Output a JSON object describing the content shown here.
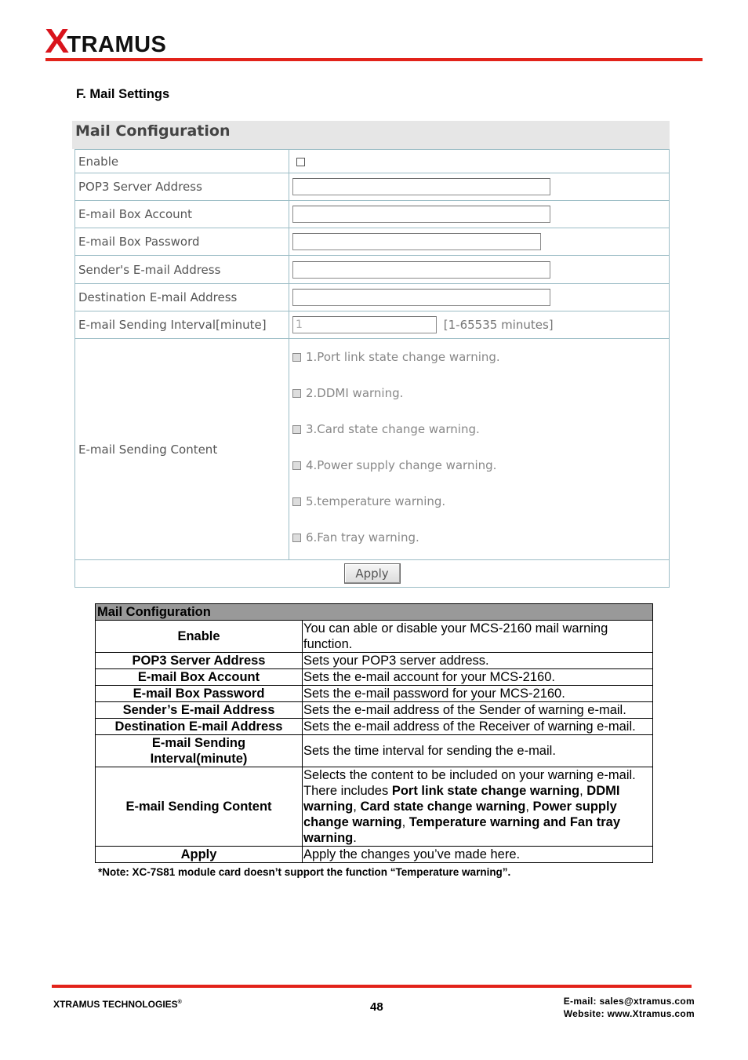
{
  "header": {
    "logo_x": "X",
    "logo_rest": "TRAMUS",
    "brand_color": "#e2231a"
  },
  "section_heading": "F. Mail Settings",
  "ui_screenshot": {
    "title": "Mail Configuration",
    "rows": [
      {
        "label": "Enable",
        "type": "checkbox",
        "checked": false
      },
      {
        "label": "POP3 Server Address",
        "type": "text",
        "value": ""
      },
      {
        "label": "E-mail Box Account",
        "type": "text",
        "value": ""
      },
      {
        "label": "E-mail Box Password",
        "type": "password",
        "value": ""
      },
      {
        "label": "Sender's E-mail Address",
        "type": "text",
        "value": ""
      },
      {
        "label": "Destination E-mail Address",
        "type": "text",
        "value": ""
      },
      {
        "label": "E-mail Sending Interval[minute]",
        "type": "text",
        "value": "1",
        "hint": "[1-65535 minutes]"
      }
    ],
    "content_label": "E-mail Sending Content",
    "content_options": [
      "1.Port link state change warning.",
      "2.DDMI warning.",
      "3.Card state change warning.",
      "4.Power supply change warning.",
      "5.temperature warning.",
      "6.Fan tray warning."
    ],
    "apply_label": "Apply"
  },
  "desc_table": {
    "title": "Mail Configuration",
    "rows": [
      {
        "key": "Enable",
        "value": "You can able or disable your MCS-2160 mail warning function."
      },
      {
        "key": "POP3 Server Address",
        "value": "Sets your POP3 server address."
      },
      {
        "key": "E-mail Box Account",
        "value": "Sets the e-mail account for your MCS-2160."
      },
      {
        "key": "E-mail Box Password",
        "value": "Sets the e-mail password for your MCS-2160."
      },
      {
        "key": "Sender’s E-mail Address",
        "value": "Sets the e-mail address of the Sender of warning e-mail."
      },
      {
        "key": "Destination E-mail Address",
        "value": "Sets the e-mail address of the Receiver of warning e-mail."
      },
      {
        "key": "E-mail Sending Interval(minute)",
        "value": "Sets the time interval for sending the e-mail."
      },
      {
        "key": "E-mail Sending Content",
        "value_parts": [
          {
            "t": "Selects the content to be included on your warning e-mail. There includes ",
            "b": false
          },
          {
            "t": "Port link state change warning",
            "b": true
          },
          {
            "t": ", ",
            "b": false
          },
          {
            "t": "DDMI warning",
            "b": true
          },
          {
            "t": ", ",
            "b": false
          },
          {
            "t": "Card state change warning",
            "b": true
          },
          {
            "t": ", ",
            "b": false
          },
          {
            "t": "Power supply change warning",
            "b": true
          },
          {
            "t": ", ",
            "b": false
          },
          {
            "t": "Temperature warning and Fan tray warning",
            "b": true
          },
          {
            "t": ".",
            "b": false
          }
        ]
      },
      {
        "key": "Apply",
        "value": "Apply the changes you’ve made here."
      }
    ],
    "note": "*Note: XC-7S81 module card doesn’t support the function “Temperature warning”."
  },
  "footer": {
    "company": "XTRAMUS TECHNOLOGIES",
    "registered": "®",
    "page_number": "48",
    "email": "E-mail: sales@xtramus.com",
    "website": "Website:  www.Xtramus.com"
  }
}
